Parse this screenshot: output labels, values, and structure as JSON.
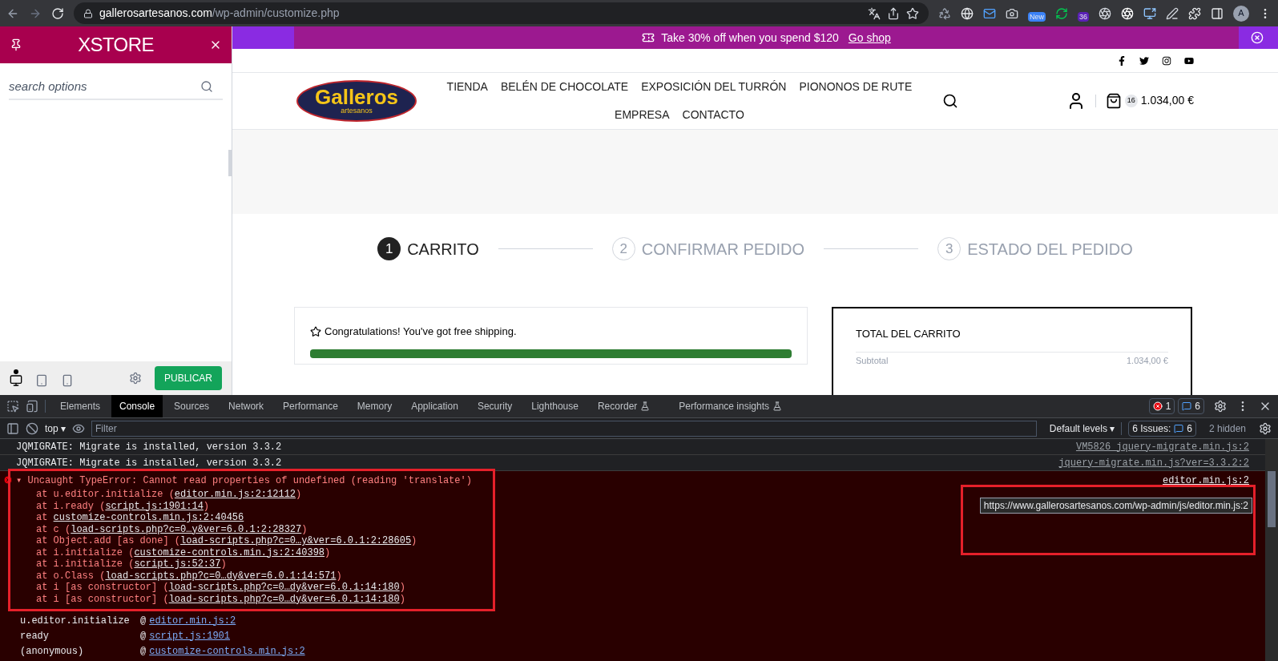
{
  "browser": {
    "url_host": "gallerosartesanos.com",
    "url_path": "/wp-admin/customize.php",
    "badges": [
      "New",
      "36"
    ],
    "avatar": "A"
  },
  "customizer": {
    "brand": "XSTORE",
    "search": {
      "placeholder": "search options"
    },
    "devices": [
      {
        "kind": "desktop",
        "selected": true
      },
      {
        "kind": "tablet",
        "selected": false
      },
      {
        "kind": "mobile",
        "selected": false
      }
    ],
    "publish": "PUBLICAR"
  },
  "site": {
    "promo": {
      "text": "Take 30% off when you spend $120",
      "link": "Go shop"
    },
    "logo": {
      "name": "Galleros",
      "tagline": "artesanos"
    },
    "nav": [
      [
        "TIENDA",
        "BELÉN DE CHOCOLATE",
        "EXPOSICIÓN DEL TURRÓN",
        "PIONONOS DE RUTE"
      ],
      [
        "EMPRESA",
        "CONTACTO"
      ]
    ],
    "cart": {
      "count": "16",
      "total": "1.034,00 €"
    },
    "steps": [
      {
        "number": "1",
        "label": "CARRITO",
        "selected": true
      },
      {
        "number": "2",
        "label": "CONFIRMAR PEDIDO",
        "selected": false
      },
      {
        "number": "3",
        "label": "ESTADO DEL PEDIDO",
        "selected": false
      }
    ],
    "shipping": {
      "text": "Congratulations! You've got free shipping.",
      "level": 1
    },
    "totals": {
      "title": "TOTAL DEL CARRITO",
      "label": "Subtotal",
      "value": "1.034,00 €"
    }
  },
  "devtools": {
    "tabs": [
      {
        "label": "Elements",
        "selected": false
      },
      {
        "label": "Console",
        "selected": true
      },
      {
        "label": "Sources",
        "selected": false
      },
      {
        "label": "Network",
        "selected": false
      },
      {
        "label": "Performance",
        "selected": false
      },
      {
        "label": "Memory",
        "selected": false
      },
      {
        "label": "Application",
        "selected": false
      },
      {
        "label": "Security",
        "selected": false
      },
      {
        "label": "Lighthouse",
        "selected": false
      },
      {
        "label": "Recorder",
        "selected": false,
        "experimental": true
      },
      {
        "label": "Performance insights",
        "selected": false,
        "experimental": true
      }
    ],
    "error_count": "1",
    "message_count": "6",
    "context": {
      "label": "top",
      "caret": "▾"
    },
    "filter": {
      "placeholder": "Filter"
    },
    "levels": {
      "label": "Default levels",
      "caret": "▾"
    },
    "issues_label": "6 Issues:",
    "issues_count": "6",
    "hidden": "2 hidden",
    "logs": [
      {
        "text": "JQMIGRATE: Migrate is installed, version 3.3.2",
        "source": "VM5826 jquery-migrate.min.js:2"
      },
      {
        "text": "JQMIGRATE: Migrate is installed, version 3.3.2",
        "source": "jquery-migrate.min.js?ver=3.3.2:2"
      }
    ],
    "error": {
      "expand": "▾",
      "title": "Uncaught TypeError: Cannot read properties of undefined (reading 'translate')",
      "source": "editor.min.js:2",
      "stack": [
        {
          "before": "at u.editor.initialize (",
          "link": "editor.min.js:2:12112",
          "after": ")"
        },
        {
          "before": "at i.ready (",
          "link": "script.js:1901:14",
          "after": ")"
        },
        {
          "before": "at ",
          "link": "customize-controls.min.js:2:40456"
        },
        {
          "before": "at c (",
          "link": "load-scripts.php?c=0…y&ver=6.0.1:2:28327",
          "after": ")"
        },
        {
          "before": "at Object.add [as done] (",
          "link": "load-scripts.php?c=0…y&ver=6.0.1:2:28605",
          "after": ")"
        },
        {
          "before": "at i.initialize (",
          "link": "customize-controls.min.js:2:40398",
          "after": ")"
        },
        {
          "before": "at i.initialize (",
          "link": "script.js:52:37",
          "after": ")"
        },
        {
          "before": "at o.Class (",
          "link": "load-scripts.php?c=0…dy&ver=6.0.1:14:571",
          "after": ")"
        },
        {
          "before": "at i [as constructor] (",
          "link": "load-scripts.php?c=0…dy&ver=6.0.1:14:180",
          "after": ")"
        },
        {
          "before": "at i [as constructor] (",
          "link": "load-scripts.php?c=0…dy&ver=6.0.1:14:180",
          "after": ")"
        }
      ],
      "call_stack": [
        {
          "fn": "u.editor.initialize",
          "at": "@",
          "link": "editor.min.js:2"
        },
        {
          "fn": "ready",
          "at": "@",
          "link": "script.js:1901"
        },
        {
          "fn": "(anonymous)",
          "at": "@",
          "link": "customize-controls.min.js:2"
        }
      ],
      "tooltip": "https://www.gallerosartesanos.com/wp-admin/js/editor.min.js:2"
    }
  }
}
